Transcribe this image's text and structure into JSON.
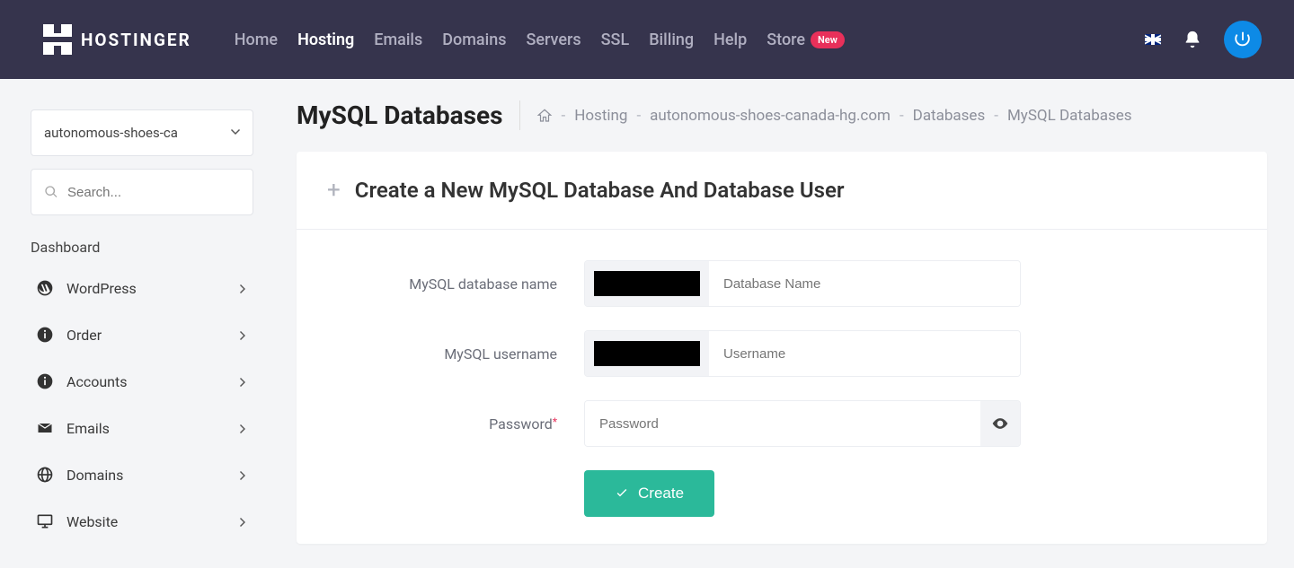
{
  "brand": {
    "name": "HOSTINGER"
  },
  "nav": {
    "home": "Home",
    "hosting": "Hosting",
    "emails": "Emails",
    "domains": "Domains",
    "servers": "Servers",
    "ssl": "SSL",
    "billing": "Billing",
    "help": "Help",
    "store": "Store",
    "store_badge": "New"
  },
  "header_icons": {
    "flag": "uk-flag-icon",
    "bell": "bell-icon",
    "avatar": "power-icon"
  },
  "sidebar": {
    "site_selected": "autonomous-shoes-ca",
    "search_placeholder": "Search...",
    "dashboard_label": "Dashboard",
    "items": [
      {
        "icon": "wordpress-icon",
        "label": "WordPress"
      },
      {
        "icon": "info-icon",
        "label": "Order"
      },
      {
        "icon": "info-icon",
        "label": "Accounts"
      },
      {
        "icon": "envelope-icon",
        "label": "Emails"
      },
      {
        "icon": "globe-icon",
        "label": "Domains"
      },
      {
        "icon": "monitor-icon",
        "label": "Website"
      }
    ]
  },
  "page": {
    "title": "MySQL Databases",
    "breadcrumb": {
      "home_icon": "home-icon",
      "hosting": "Hosting",
      "domain": "autonomous-shoes-canada-hg.com",
      "databases": "Databases",
      "current": "MySQL Databases"
    }
  },
  "card": {
    "heading": "Create a New MySQL Database And Database User",
    "fields": {
      "db_name": {
        "label": "MySQL database name",
        "placeholder": "Database Name"
      },
      "username": {
        "label": "MySQL username",
        "placeholder": "Username"
      },
      "password": {
        "label": "Password",
        "required": true,
        "placeholder": "Password"
      }
    },
    "submit_label": "Create"
  }
}
